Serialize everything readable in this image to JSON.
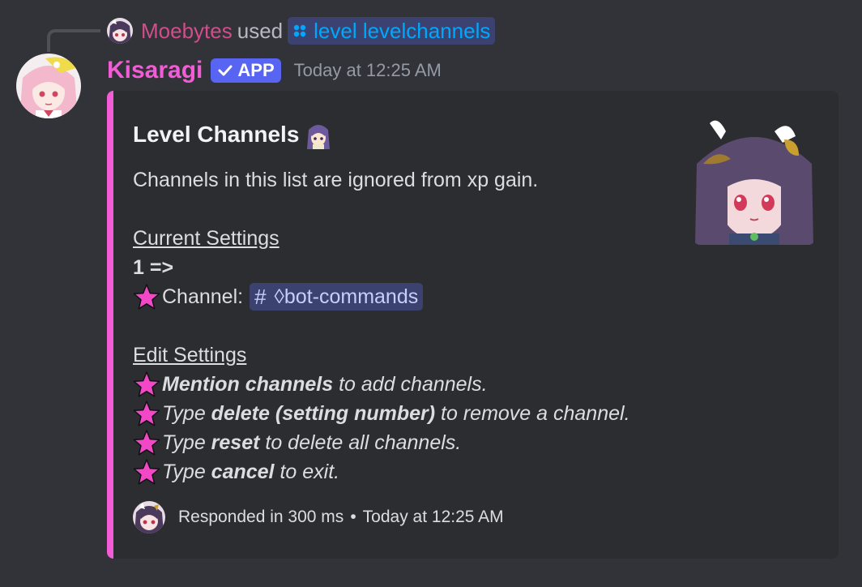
{
  "reply": {
    "username": "Moebytes",
    "used_text": "used",
    "command_label": "level levelchannels",
    "command_icon": "apps-icon"
  },
  "message": {
    "username": "Kisaragi",
    "badge_label": "APP",
    "timestamp": "Today at 12:25 AM"
  },
  "embed": {
    "accent_color": "#f25cd6",
    "title": "Level Channels",
    "description": "Channels in this list are ignored from xp gain.",
    "current_settings": {
      "heading": "Current Settings",
      "entry_number": "1 =>",
      "channel_label": "Channel:",
      "channel_hash": "#",
      "channel_name": "◊bot-commands"
    },
    "edit_settings": {
      "heading": "Edit Settings",
      "lines": [
        {
          "strong": "Mention channels",
          "rest": " to add channels."
        },
        {
          "pre": "Type ",
          "strong": "delete (setting number)",
          "rest": " to remove a channel."
        },
        {
          "pre": "Type ",
          "strong": "reset",
          "rest": " to delete all channels."
        },
        {
          "pre": "Type ",
          "strong": "cancel",
          "rest": " to exit."
        }
      ]
    },
    "footer": {
      "responded": "Responded in 300 ms",
      "separator": "•",
      "timestamp": "Today at 12:25 AM"
    }
  },
  "colors": {
    "background": "#313338",
    "embed_background": "#2b2d31",
    "username": "#f25cd6",
    "reply_username": "#d14d8b",
    "mention_text": "#00a8fc",
    "badge": "#5865f2"
  }
}
